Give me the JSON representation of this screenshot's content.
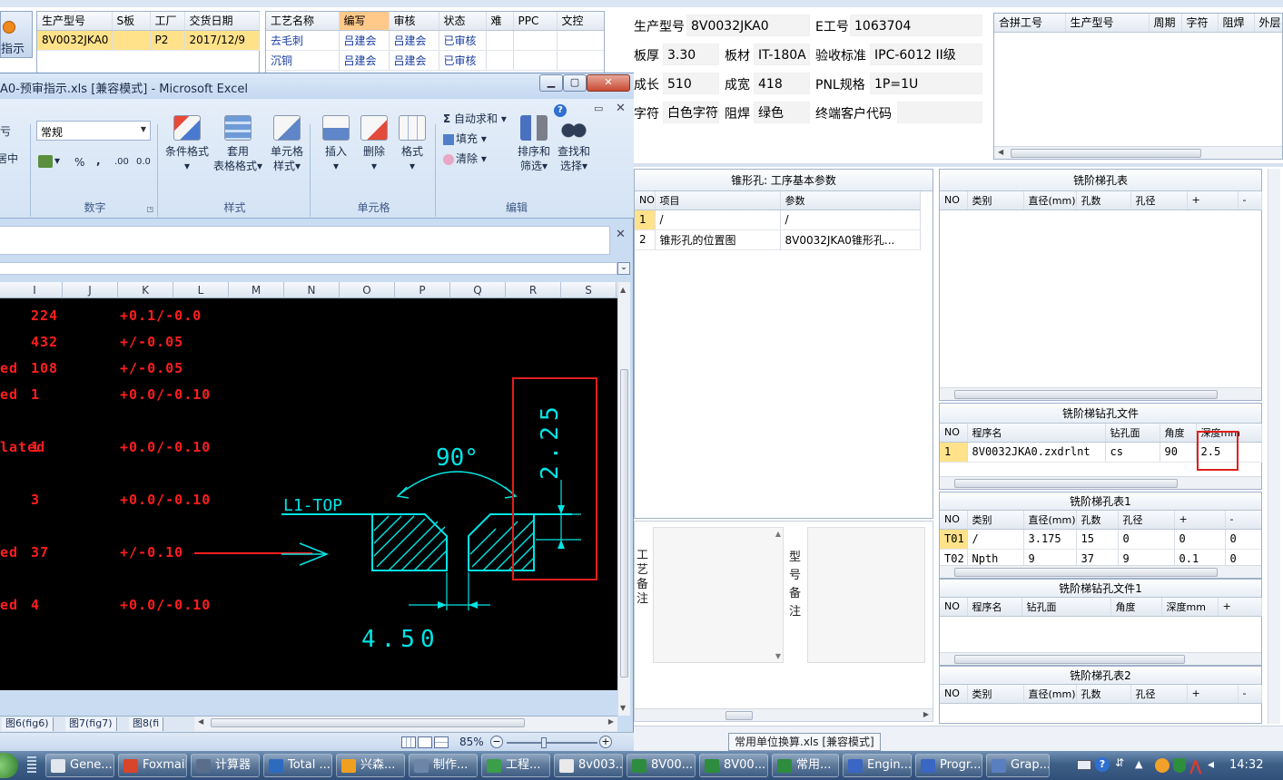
{
  "erp": {
    "top_left_button": "指示",
    "order_table": {
      "headers": [
        "生产型号",
        "S板",
        "工厂",
        "交货日期"
      ],
      "rows": [
        [
          "8V0032JKA0",
          "",
          "P2",
          "2017/12/9"
        ]
      ]
    },
    "process_table": {
      "headers": [
        "工艺名称",
        "编写",
        "审核",
        "状态",
        "难",
        "PPC",
        "文控"
      ],
      "rows": [
        [
          "去毛刺",
          "吕建会",
          "吕建会",
          "已审核",
          "",
          "",
          ""
        ],
        [
          "沉铜",
          "吕建会",
          "吕建会",
          "已审核",
          "",
          "",
          ""
        ]
      ]
    },
    "info": {
      "model_label": "生产型号",
      "model_value": "8V0032JKA0",
      "eno_label": "E工号",
      "eno_value": "1063704",
      "thick_label": "板厚",
      "thick_value": "3.30",
      "mat_label": "板材",
      "mat_value": "IT-180A",
      "std_label": "验收标准",
      "std_value": "IPC-6012 II级",
      "len_label": "成长",
      "len_value": "510",
      "wid_label": "成宽",
      "wid_value": "418",
      "pnl_label": "PNL规格",
      "pnl_value": "1P=1U",
      "char_label": "字符",
      "char_value": "白色字符",
      "mask_label": "阻焊",
      "mask_value": "绿色",
      "cust_label": "终端客户代码",
      "cust_value": ""
    },
    "combine_table": {
      "headers": [
        "合拼工号",
        "生产型号",
        "周期",
        "字符",
        "阻焊",
        "外层"
      ]
    },
    "cone_panel": {
      "title": "锥形孔: 工序基本参数",
      "headers": [
        "NO",
        "项目",
        "参数"
      ],
      "rows": [
        [
          "1",
          "/",
          "/"
        ],
        [
          "2",
          "锥形孔的位置图",
          "8V0032JKA0锥形孔..."
        ]
      ]
    },
    "process_note_label": "工艺备注",
    "model_note_label": "型号备注",
    "mill_step": {
      "title": "铣阶梯孔表",
      "headers": [
        "NO",
        "类别",
        "直径(mm)",
        "孔数",
        "孔径",
        "+",
        "-"
      ]
    },
    "mill_step_file": {
      "title": "铣阶梯钻孔文件",
      "headers": [
        "NO",
        "程序名",
        "钻孔面",
        "角度",
        "深度mm"
      ],
      "rows": [
        [
          "1",
          "8V0032JKA0.zxdrlnt",
          "cs",
          "90",
          "2.5"
        ]
      ]
    },
    "mill_step1": {
      "title": "铣阶梯孔表1",
      "headers": [
        "NO",
        "类别",
        "直径(mm)",
        "孔数",
        "孔径",
        "+",
        "-"
      ],
      "rows": [
        [
          "T01",
          "/",
          "3.175",
          "15",
          "0",
          "0",
          "0"
        ],
        [
          "T02",
          "Npth",
          "9",
          "37",
          "9",
          "0.1",
          "0"
        ]
      ]
    },
    "mill_step_file1": {
      "title": "铣阶梯钻孔文件1",
      "headers": [
        "NO",
        "程序名",
        "钻孔面",
        "角度",
        "深度mm",
        "+"
      ]
    },
    "mill_step2": {
      "title": "铣阶梯孔表2",
      "headers": [
        "NO",
        "类别",
        "直径(mm)",
        "孔数",
        "孔径",
        "+",
        "-"
      ]
    },
    "bottom_tooltip": "常用单位换算.xls [兼容模式]"
  },
  "excel": {
    "title": "A0-预审指示.xls [兼容模式] - Microsoft Excel",
    "number_format": "常规",
    "group_labels": {
      "number": "数字",
      "style": "样式",
      "cells": "单元格",
      "edit": "编辑"
    },
    "buttons": {
      "cond_format": "条件格式",
      "table_format_1": "套用",
      "table_format_2": "表格格式",
      "cell_style_1": "单元格",
      "cell_style_2": "样式",
      "insert": "插入",
      "delete": "删除",
      "format": "格式",
      "autosum": "自动求和",
      "fill": "填充",
      "clear": "清除",
      "sort_1": "排序和",
      "sort_2": "筛选",
      "find_1": "查找和",
      "find_2": "选择",
      "left_partial_1": "亏",
      "left_partial_2": "居中",
      "percent": "%",
      "comma": ",",
      "inc_decimal": ".00",
      "dec_decimal": "0.0"
    },
    "columns": [
      "I",
      "J",
      "K",
      "L",
      "M",
      "N",
      "O",
      "P",
      "Q",
      "R",
      "S"
    ],
    "rows": [
      {
        "left": "",
        "num": "224",
        "tol": "+0.1/-0.0"
      },
      {
        "left": "",
        "num": "432",
        "tol": "+/-0.05"
      },
      {
        "left": "ed",
        "num": "108",
        "tol": "+/-0.05"
      },
      {
        "left": "ed",
        "num": "1",
        "tol": "+0.0/-0.10"
      },
      {
        "left": "lated",
        "num": "1",
        "tol": "+0.0/-0.10"
      },
      {
        "left": "",
        "num": "3",
        "tol": "+0.0/-0.10"
      },
      {
        "left": "ed",
        "num": "37",
        "tol": "+/-0.10"
      },
      {
        "left": "ed",
        "num": "4",
        "tol": "+0.0/-0.10"
      }
    ],
    "drawing": {
      "angle": "90°",
      "layer": "L1-TOP",
      "width": "4.50",
      "depth": "2.25"
    },
    "sheet_tabs": [
      "图6(fig6)",
      "图7(fig7)",
      "图8(fi"
    ],
    "zoom": "85%"
  },
  "taskbar": {
    "items": [
      "Gene...",
      "Foxmail",
      "计算器",
      "Total ...",
      "兴森...",
      "制作...",
      "工程...",
      "8v003...",
      "8V00...",
      "8V00...",
      "常用...",
      "Engin...",
      "Progr...",
      "Grap..."
    ],
    "clock": "14:32"
  }
}
